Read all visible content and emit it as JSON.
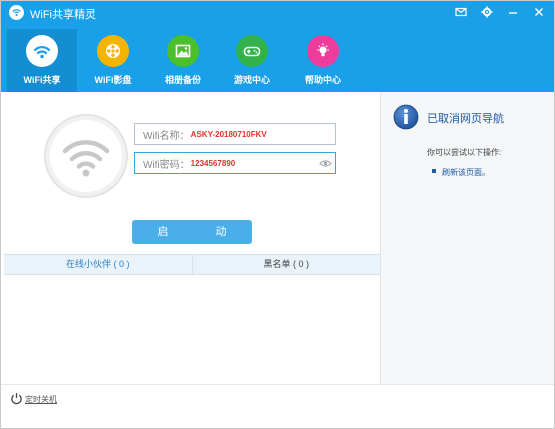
{
  "app": {
    "title": "WiFi共享精灵"
  },
  "window_controls": [
    {
      "name": "mail-icon"
    },
    {
      "name": "gear-icon"
    },
    {
      "name": "minimize-icon"
    },
    {
      "name": "close-icon"
    }
  ],
  "nav": [
    {
      "label": "WiFi共享",
      "icon": "wifi-icon",
      "color": "#1aa0e8",
      "active": true
    },
    {
      "label": "WiFi影盘",
      "icon": "film-reel-icon",
      "color": "#f5b400"
    },
    {
      "label": "相册备份",
      "icon": "photo-icon",
      "color": "#4ac02b"
    },
    {
      "label": "游戏中心",
      "icon": "gamepad-icon",
      "color": "#31b24a"
    },
    {
      "label": "帮助中心",
      "icon": "lightbulb-icon",
      "color": "#ee3c9c"
    }
  ],
  "form": {
    "ssid_label": "Wifi名称：",
    "ssid_value": "ASKY-20180710FKV",
    "password_label": "Wifi密码：",
    "password_value": "1234567890"
  },
  "start_button": "启　动",
  "tabs": [
    {
      "label": "在线小伙伴 ( 0 )"
    },
    {
      "label": "黑名单 ( 0 )"
    }
  ],
  "side": {
    "title": "已取消网页导航",
    "hint": "你可以尝试以下操作:",
    "link": "刷新该页面。"
  },
  "footer": {
    "link": "定时关机"
  },
  "colors": {
    "header": "#1aa0e8",
    "accent": "#4aaee8",
    "error_text": "#e0332b"
  }
}
